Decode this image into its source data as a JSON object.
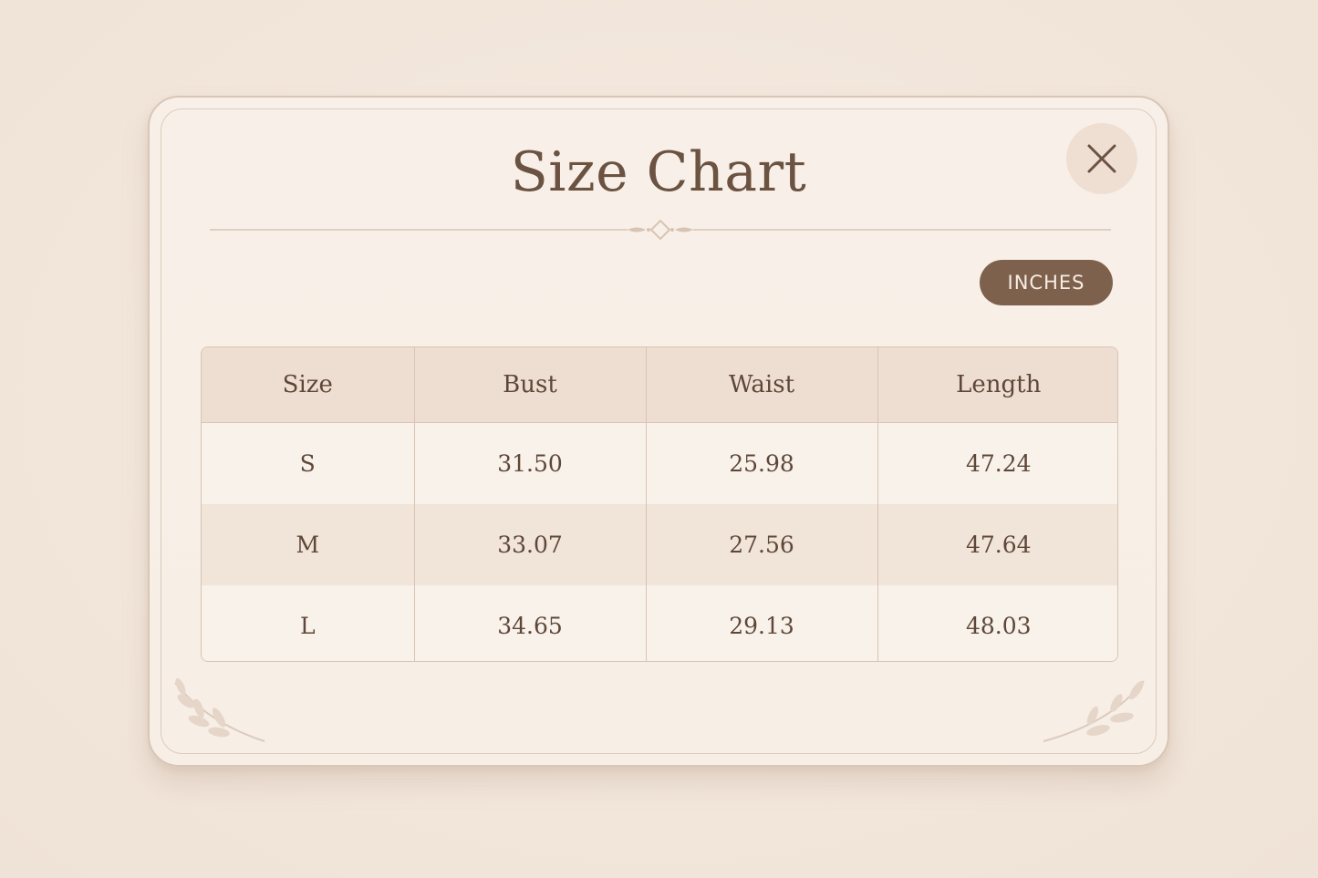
{
  "modal": {
    "title": "Size Chart",
    "close_label": "Close",
    "unit_badge": "INCHES"
  },
  "table": {
    "headers": [
      "Size",
      "Bust",
      "Waist",
      "Length"
    ],
    "rows": [
      [
        "S",
        "31.50",
        "25.98",
        "47.24"
      ],
      [
        "M",
        "33.07",
        "27.56",
        "47.64"
      ],
      [
        "L",
        "34.65",
        "29.13",
        "48.03"
      ]
    ]
  },
  "colors": {
    "background": "#f4e9df",
    "modal": "#f8f0e8",
    "accent": "#7e614c",
    "text": "#6b5241",
    "header_row": "#eeded1",
    "alt_row": "#f1e4d9"
  },
  "icons": {
    "close": "close-icon",
    "divider_ornament": "diamond-ornament-icon",
    "corner_decor": "leaf-sprig-icon"
  }
}
